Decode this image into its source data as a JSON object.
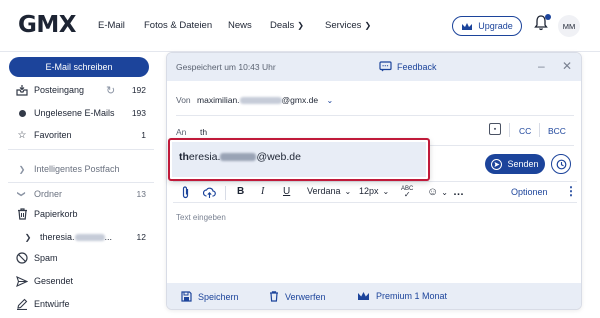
{
  "topnav": {
    "logo": "GMX",
    "links": [
      "E-Mail",
      "Fotos & Dateien",
      "News",
      "Deals",
      "Services"
    ],
    "upgrade_label": "Upgrade",
    "avatar_initials": "MM"
  },
  "sidebar": {
    "compose_label": "E-Mail schreiben",
    "items": [
      {
        "label": "Posteingang",
        "count": "192"
      },
      {
        "label": "Ungelesene E-Mails",
        "count": "193"
      },
      {
        "label": "Favoriten",
        "count": "1"
      },
      {
        "label": "Intelligentes Postfach",
        "count": ""
      },
      {
        "label": "Ordner",
        "count": "13"
      },
      {
        "label": "Papierkorb",
        "count": ""
      },
      {
        "label": "theresia.",
        "count": "12"
      },
      {
        "label": "Spam",
        "count": ""
      },
      {
        "label": "Gesendet",
        "count": ""
      },
      {
        "label": "Entwürfe",
        "count": ""
      }
    ]
  },
  "compose": {
    "saved_text": "Gespeichert um 10:43 Uhr",
    "feedback_label": "Feedback",
    "from_label": "Von",
    "from_address_start": "maximilian.",
    "from_address_end": "@gmx.de",
    "to_label": "An",
    "to_value": "th",
    "cc_label": "CC",
    "bcc_label": "BCC",
    "send_label": "Senden",
    "toolbar": {
      "font": "Verdana",
      "size": "12px",
      "options_label": "Optionen"
    },
    "body_placeholder": "Text eingeben",
    "footer": {
      "save_label": "Speichern",
      "discard_label": "Verwerfen",
      "premium_label": "Premium 1 Monat"
    }
  },
  "autocomplete": {
    "match": "th",
    "rest": "eresia.",
    "domain": "@web.de"
  },
  "colors": {
    "brand_blue": "#1c449b",
    "highlight_red": "#c01a3a",
    "panel_bg": "#e8edf6"
  }
}
